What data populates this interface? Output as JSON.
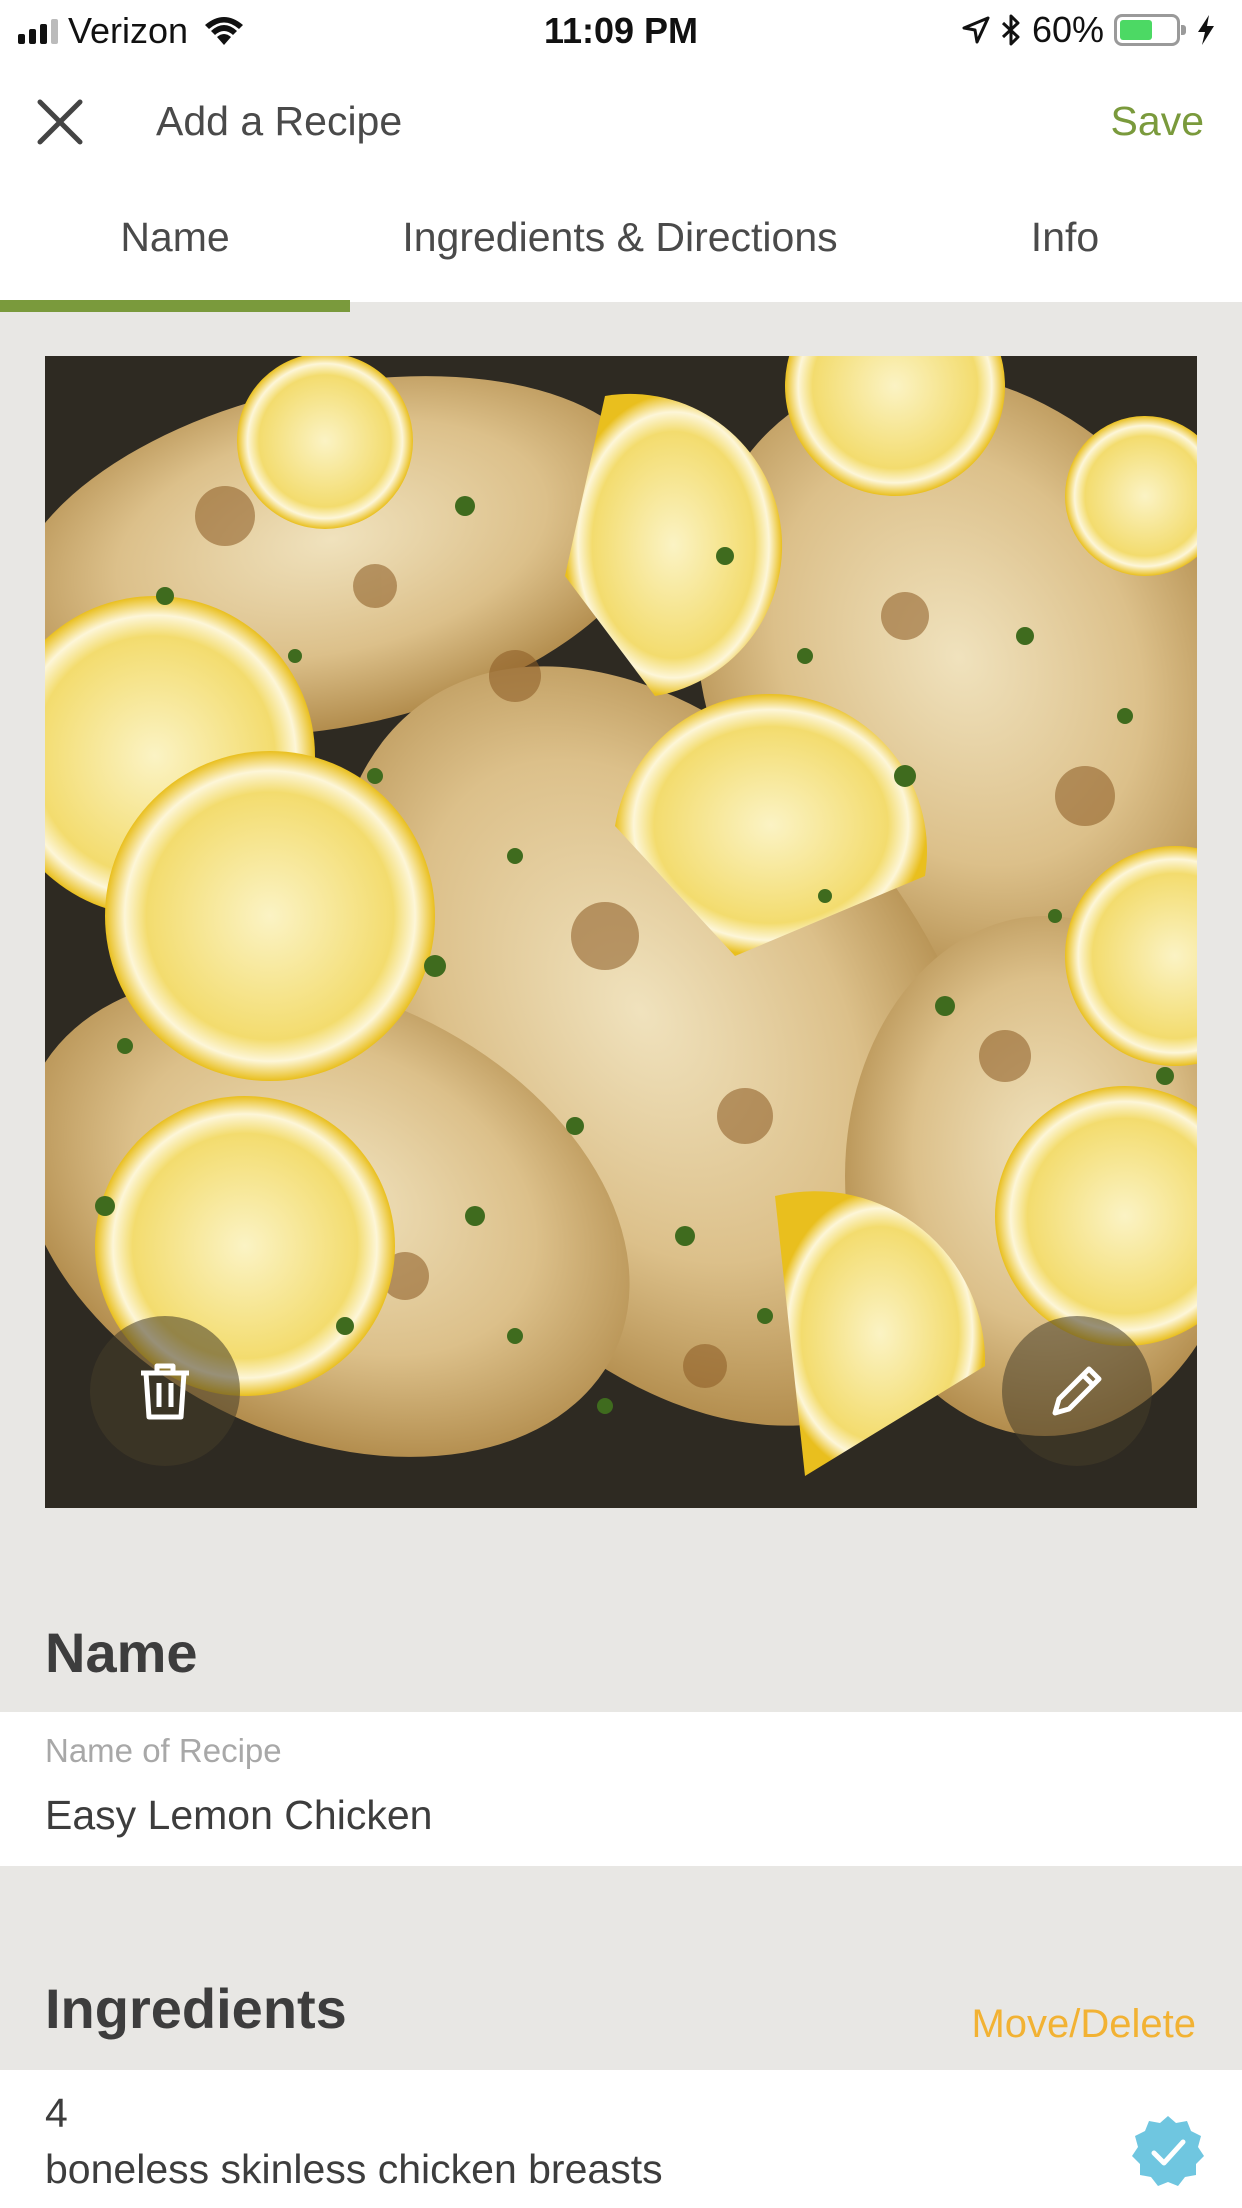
{
  "status_bar": {
    "carrier": "Verizon",
    "time": "11:09 PM",
    "battery_percent": "60%",
    "battery_level": 0.6,
    "icons": [
      "signal-icon",
      "wifi-icon",
      "location-icon",
      "bluetooth-icon",
      "battery-icon",
      "charging-icon"
    ]
  },
  "header": {
    "title": "Add a Recipe",
    "save_label": "Save",
    "close_icon": "close-icon"
  },
  "tabs": [
    {
      "label": "Name",
      "active": true
    },
    {
      "label": "Ingredients & Directions",
      "active": false
    },
    {
      "label": "Info",
      "active": false
    }
  ],
  "photo": {
    "delete_icon": "trash-icon",
    "edit_icon": "pencil-icon"
  },
  "name_section": {
    "title": "Name",
    "field_label": "Name of Recipe",
    "field_value": "Easy Lemon Chicken"
  },
  "ingredients_section": {
    "title": "Ingredients",
    "move_delete_label": "Move/Delete",
    "items": [
      {
        "quantity": "4",
        "name": "boneless skinless chicken breasts",
        "checked": true
      }
    ]
  },
  "colors": {
    "accent_green": "#7a9a3c",
    "accent_orange": "#f2b233",
    "check_blue": "#6fc6e0",
    "background": "#e8e7e4"
  }
}
